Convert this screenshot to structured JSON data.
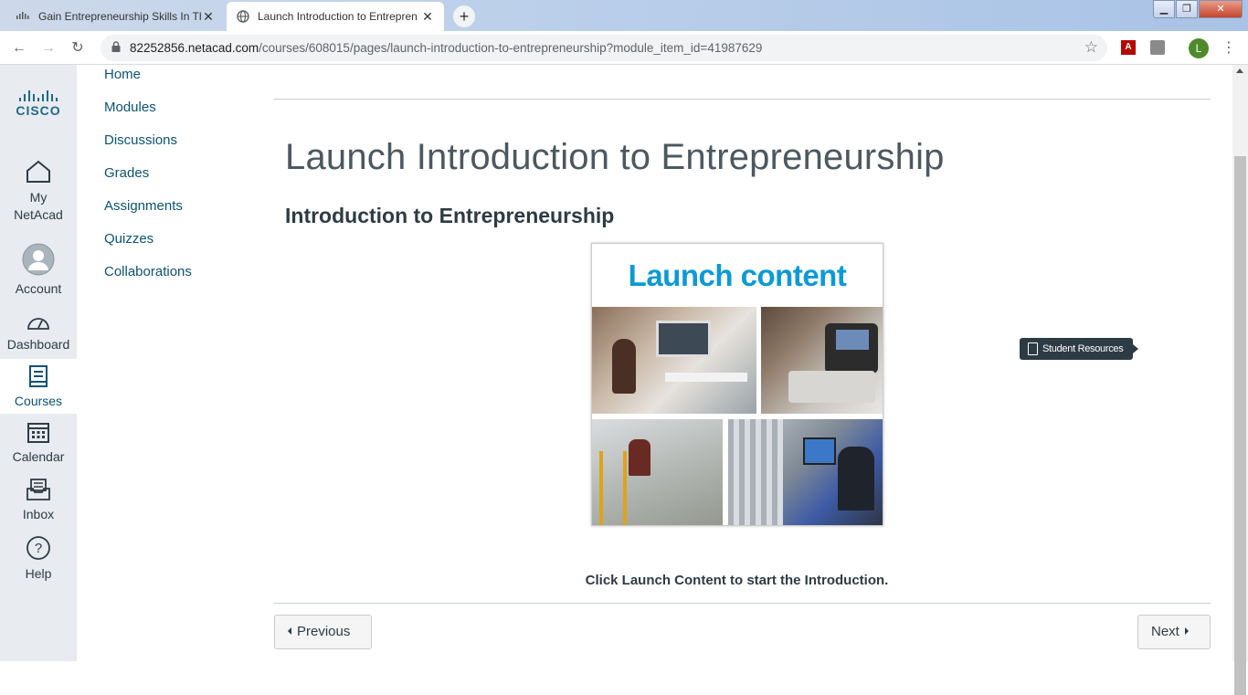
{
  "browser": {
    "tabs": [
      {
        "title": "Gain Entrepreneurship Skills In Th",
        "active": false
      },
      {
        "title": "Launch Introduction to Entrepren",
        "active": true
      }
    ],
    "new_tab_symbol": "+",
    "url_host": "82252856.netacad.com",
    "url_path": "/courses/608015/pages/launch-introduction-to-entrepreneurship?module_item_id=41987629",
    "profile_initial": "L"
  },
  "global_nav": {
    "logo_text": "CISCO",
    "items": [
      {
        "label": "My NetAcad",
        "icon": "home-icon",
        "active": false
      },
      {
        "label": "Account",
        "icon": "account-icon",
        "active": false
      },
      {
        "label": "Dashboard",
        "icon": "dashboard-icon",
        "active": false
      },
      {
        "label": "Courses",
        "icon": "courses-icon",
        "active": true
      },
      {
        "label": "Calendar",
        "icon": "calendar-icon",
        "active": false
      },
      {
        "label": "Inbox",
        "icon": "inbox-icon",
        "active": false
      },
      {
        "label": "Help",
        "icon": "help-icon",
        "active": false
      }
    ]
  },
  "course_nav": {
    "items": [
      "Home",
      "Modules",
      "Discussions",
      "Grades",
      "Assignments",
      "Quizzes",
      "Collaborations"
    ]
  },
  "page": {
    "title": "Launch Introduction to Entrepreneurship",
    "subtitle": "Introduction to Entrepreneurship",
    "launch_image_text": "Launch content",
    "instruction": "Click Launch Content to start the Introduction.",
    "tooltip": "Student Resources",
    "prev_label": "Previous",
    "next_label": "Next"
  },
  "colors": {
    "link": "#0b5373",
    "accent": "#0b9ad6",
    "nav_bg": "#e8ebef"
  }
}
